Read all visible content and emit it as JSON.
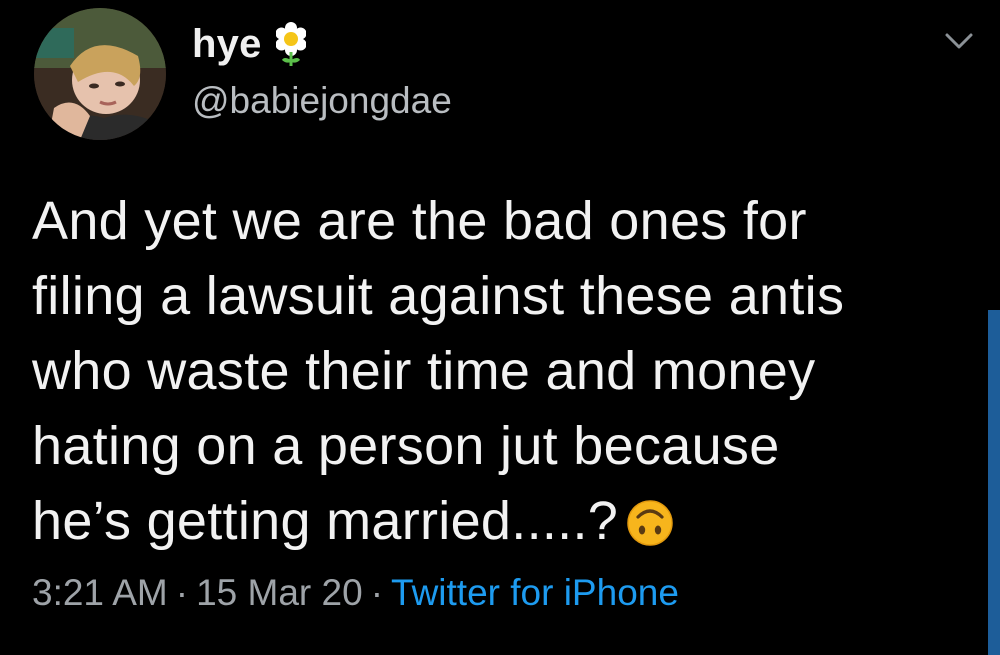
{
  "tweet": {
    "author": {
      "display_name": "hye",
      "handle": "@babiejongdae",
      "name_badge_icon": "flower-icon",
      "avatar_icon": "user-avatar"
    },
    "text_lines": [
      "And yet we are the bad ones for",
      "filing a lawsuit against these antis",
      "who waste their time and money",
      "hating on a person jut because",
      "he’s getting married.....?"
    ],
    "text_emoji": "upside-down-face-emoji",
    "time": "3:21 AM",
    "separator": "·",
    "date": "15 Mar 20",
    "source": "Twitter for iPhone",
    "menu_icon": "chevron-down-icon"
  },
  "colors": {
    "background": "#000000",
    "text": "#f2f2f2",
    "muted": "#9ea3a8",
    "link": "#1d9bf0",
    "scroll_indicator": "#1d5d99"
  }
}
